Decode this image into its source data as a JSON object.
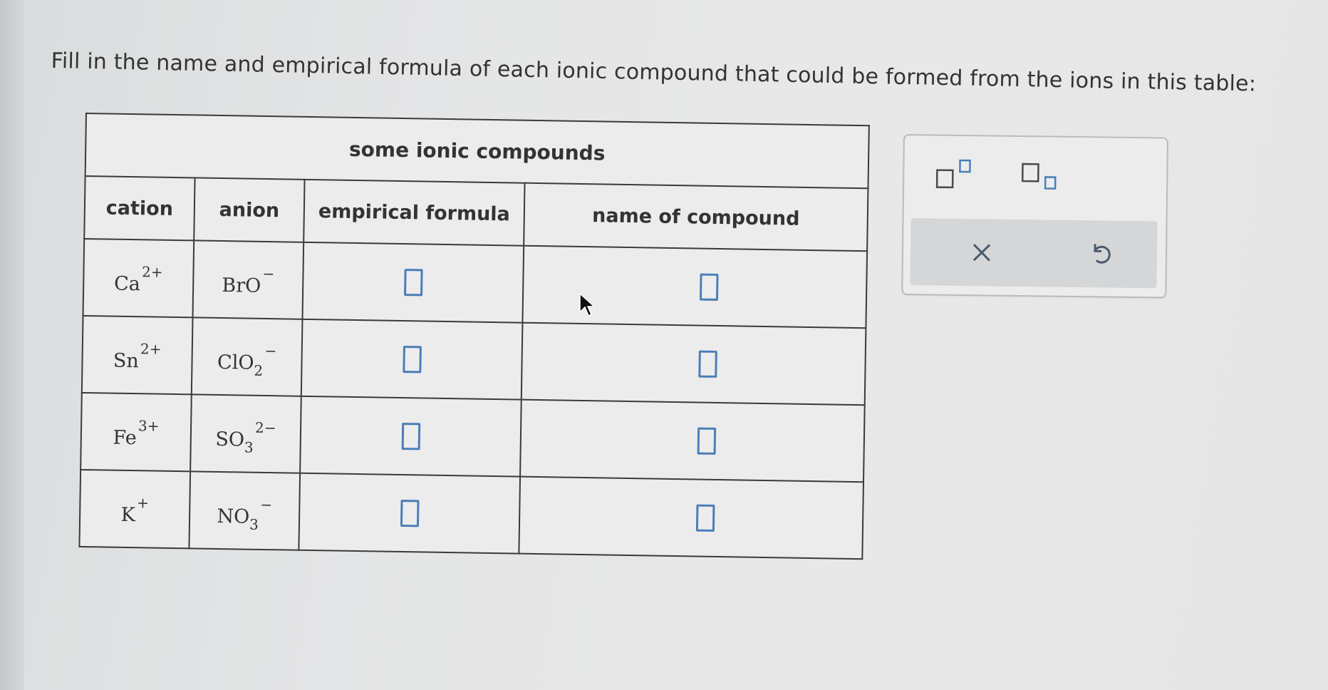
{
  "instruction": "Fill in the name and empirical formula of each ionic compound that could be formed from the ions in this table:",
  "table": {
    "caption": "some ionic compounds",
    "headers": {
      "cation": "cation",
      "anion": "anion",
      "formula": "empirical formula",
      "name": "name of compound"
    },
    "rows": [
      {
        "cation": {
          "symbol": "Ca",
          "charge": "2+"
        },
        "anion": {
          "symbol": "BrO",
          "subscript": "",
          "charge": "−"
        }
      },
      {
        "cation": {
          "symbol": "Sn",
          "charge": "2+"
        },
        "anion": {
          "symbol": "ClO",
          "subscript": "2",
          "charge": "−"
        }
      },
      {
        "cation": {
          "symbol": "Fe",
          "charge": "3+"
        },
        "anion": {
          "symbol": "SO",
          "subscript": "3",
          "charge": "2−"
        }
      },
      {
        "cation": {
          "symbol": "K",
          "charge": "+"
        },
        "anion": {
          "symbol": "NO",
          "subscript": "3",
          "charge": "−"
        }
      }
    ]
  },
  "toolbar": {
    "superscript_icon": "superscript-icon",
    "subscript_icon": "subscript-icon",
    "clear_icon": "close-icon",
    "undo_icon": "undo-icon"
  },
  "colors": {
    "answer_box": "#4a7fb8",
    "table_border": "#3a3a3a",
    "panel_action_bg": "#d4d6d8"
  }
}
